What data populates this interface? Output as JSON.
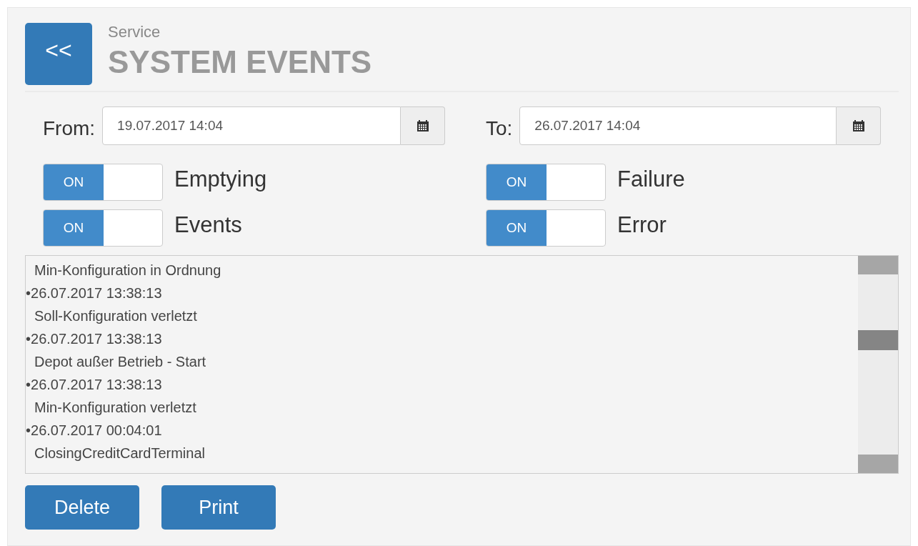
{
  "header": {
    "back_button": "<<",
    "breadcrumb": "Service",
    "title": "SYSTEM EVENTS"
  },
  "date_range": [
    {
      "label": "From:",
      "value": "19.07.2017 14:04"
    },
    {
      "label": "To:",
      "value": "26.07.2017 14:04"
    }
  ],
  "filters": [
    {
      "toggle_text": "ON",
      "on": true,
      "label": "Emptying"
    },
    {
      "toggle_text": "ON",
      "on": true,
      "label": "Failure"
    },
    {
      "toggle_text": "ON",
      "on": true,
      "label": "Events"
    },
    {
      "toggle_text": "ON",
      "on": true,
      "label": "Error"
    }
  ],
  "log": [
    {
      "kind": "message",
      "text": "Min-Konfiguration in Ordnung"
    },
    {
      "kind": "timestamp",
      "text": "•26.07.2017 13:38:13"
    },
    {
      "kind": "message",
      "text": "Soll-Konfiguration verletzt"
    },
    {
      "kind": "timestamp",
      "text": "•26.07.2017 13:38:13"
    },
    {
      "kind": "message",
      "text": "Depot außer Betrieb - Start"
    },
    {
      "kind": "timestamp",
      "text": "•26.07.2017 13:38:13"
    },
    {
      "kind": "message",
      "text": "Min-Konfiguration verletzt"
    },
    {
      "kind": "timestamp",
      "text": "•26.07.2017 00:04:01"
    },
    {
      "kind": "message",
      "text": "ClosingCreditCardTerminal"
    }
  ],
  "buttons": [
    "Delete",
    "Print"
  ]
}
